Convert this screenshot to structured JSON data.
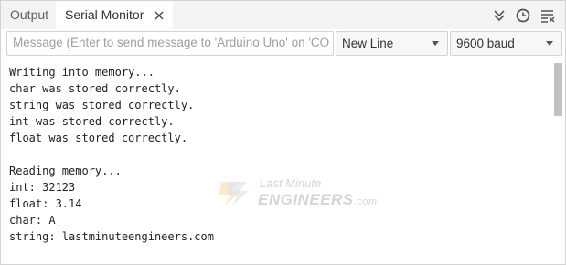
{
  "tabs": {
    "output_label": "Output",
    "serial_label": "Serial Monitor"
  },
  "input": {
    "placeholder": "Message (Enter to send message to 'Arduino Uno' on 'CO...",
    "value": ""
  },
  "line_ending": {
    "selected": "New Line"
  },
  "baud": {
    "selected": "9600 baud"
  },
  "log_lines": [
    "Writing into memory...",
    "char was stored correctly.",
    "string was stored correctly.",
    "int was stored correctly.",
    "float was stored correctly.",
    "",
    "Reading memory...",
    "int: 32123",
    "float: 3.14",
    "char: A",
    "string: lastminuteengineers.com"
  ],
  "watermark": {
    "line1": "Last Minute",
    "line2": "ENGINEERS",
    "suffix": ".com"
  },
  "icons": {
    "close": "close-icon",
    "autoscroll": "double-chevron-down-icon",
    "timestamp": "clock-icon",
    "clear": "clear-output-icon"
  },
  "colors": {
    "accent_watermark": "#f5c46a",
    "tab_bar": "#f3f3f3"
  }
}
